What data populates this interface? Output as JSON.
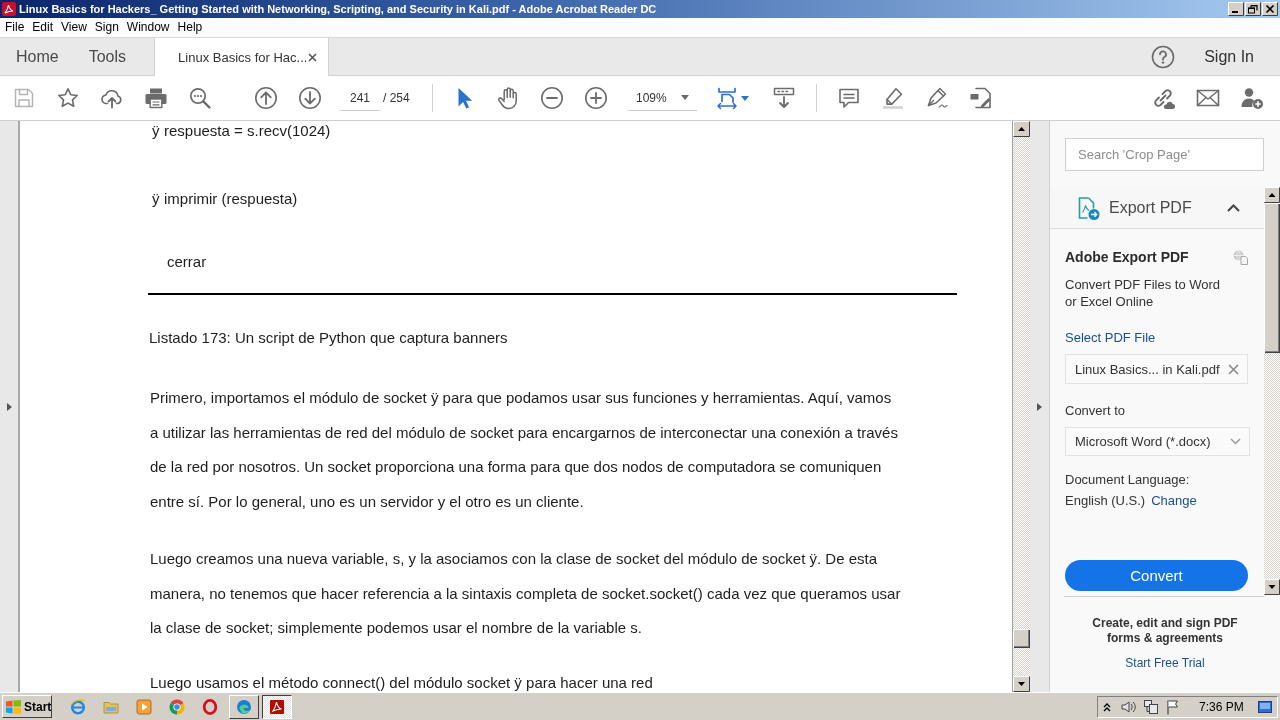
{
  "window": {
    "title": "Linux Basics for Hackers_ Getting Started with Networking, Scripting, and Security in Kali.pdf - Adobe Acrobat Reader DC"
  },
  "menu": [
    "File",
    "Edit",
    "View",
    "Sign",
    "Window",
    "Help"
  ],
  "tabs": [
    {
      "label": "Home",
      "kind": "page",
      "selected": false
    },
    {
      "label": "Tools",
      "kind": "page",
      "selected": false
    },
    {
      "label": "Linux Basics for Hac...",
      "kind": "document",
      "selected": true
    }
  ],
  "account": {
    "sign_in": "Sign In"
  },
  "toolbar": {
    "page_field": {
      "value": "241"
    },
    "page_count": "/ 254",
    "zoom_field": {
      "value": "109%"
    },
    "tools": [
      {
        "kind": "select",
        "selected": true
      },
      {
        "kind": "hand",
        "selected": false
      },
      {
        "kind": "page-fit",
        "selected": true
      }
    ]
  },
  "document": {
    "code_lines": [
      {
        "marker": "ÿ",
        "text": "respuesta = s.recv(1024)"
      },
      {
        "marker": "ÿ",
        "text": "imprimir (respuesta)"
      },
      {
        "text": "cerrar"
      }
    ],
    "caption": "Listado 173: Un script de Python que captura banners",
    "paragraphs": [
      {
        "lines": [
          "Primero, importamos el módulo de socket ÿ para que podamos usar sus funciones y herramientas. Aquí, vamos",
          "a utilizar las herramientas de red del módulo de socket para encargarnos de interconectar una conexión a través",
          "de la red por nosotros. Un socket proporciona una forma para que dos nodos de computadora se comuniquen",
          "entre sí. Por lo general, uno es un servidor y el otro es un cliente."
        ]
      },
      {
        "lines": [
          "Luego creamos una nueva variable, s, y la asociamos con la clase de socket del módulo de socket ÿ. De esta",
          "manera, no tenemos que hacer referencia a la sintaxis completa de socket.socket() cada vez que queramos usar",
          "la clase de socket; simplemente podemos usar el nombre de la variable s."
        ]
      },
      {
        "lines": [
          "Luego usamos el método connect() del módulo socket ÿ para hacer una red"
        ]
      }
    ]
  },
  "side_panel": {
    "search": {
      "placeholder": "Search 'Crop Page'"
    },
    "tool_header": {
      "title": "Export PDF",
      "expanded": true
    },
    "section_title": "Adobe Export PDF",
    "description_lines": [
      "Convert PDF Files to Word",
      "or Excel Online"
    ],
    "select_file_link": "Select PDF File",
    "file_field": {
      "value": "Linux Basics... in Kali.pdf"
    },
    "convert_to_label": "Convert to",
    "format_dropdown": {
      "value": "Microsoft Word (*.docx)"
    },
    "language_label": "Document Language:",
    "language": "English (U.S.)",
    "change_link": "Change",
    "convert_button": "Convert",
    "promo": {
      "lines": [
        "Create, edit and sign PDF",
        "forms & agreements"
      ],
      "link": "Start Free Trial"
    }
  },
  "taskbar": {
    "start": "Start",
    "windows": [
      {
        "kind": "wave",
        "selected": false
      },
      {
        "kind": "pdf",
        "selected": true
      }
    ],
    "clock": "7:36 PM"
  }
}
